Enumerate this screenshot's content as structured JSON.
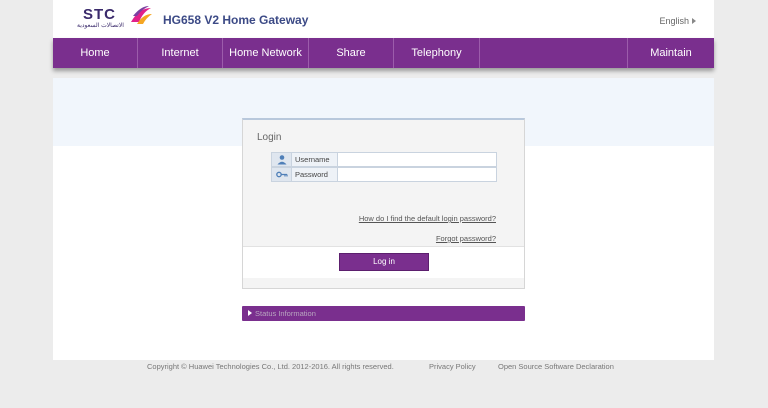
{
  "header": {
    "brand_text": "STC",
    "brand_sub": "الاتصالات السعودية",
    "product_title": "HG658 V2 Home Gateway",
    "language_label": "English"
  },
  "nav": {
    "items": [
      "Home",
      "Internet",
      "Home Network",
      "Share",
      "Telephony"
    ],
    "last_item": "Maintain"
  },
  "login": {
    "title": "Login",
    "username_label": "Username",
    "username_value": "",
    "password_label": "Password",
    "password_value": "",
    "default_password_link": "How do I find the default login password?",
    "forgot_password_link": "Forgot password?",
    "login_button": "Log in"
  },
  "status": {
    "label": "Status Information"
  },
  "footer": {
    "copyright": "Copyright © Huawei Technologies Co., Ltd. 2012-2016. All rights reserved.",
    "privacy": "Privacy Policy",
    "open_source": "Open Source Software Declaration"
  },
  "colors": {
    "accent": "#7a2f8e",
    "title_blue": "#3c4a86",
    "background": "#ececec"
  },
  "icons": [
    "stc-logo",
    "user-icon",
    "key-icon",
    "chevron-right-icon",
    "triangle-right-icon"
  ]
}
